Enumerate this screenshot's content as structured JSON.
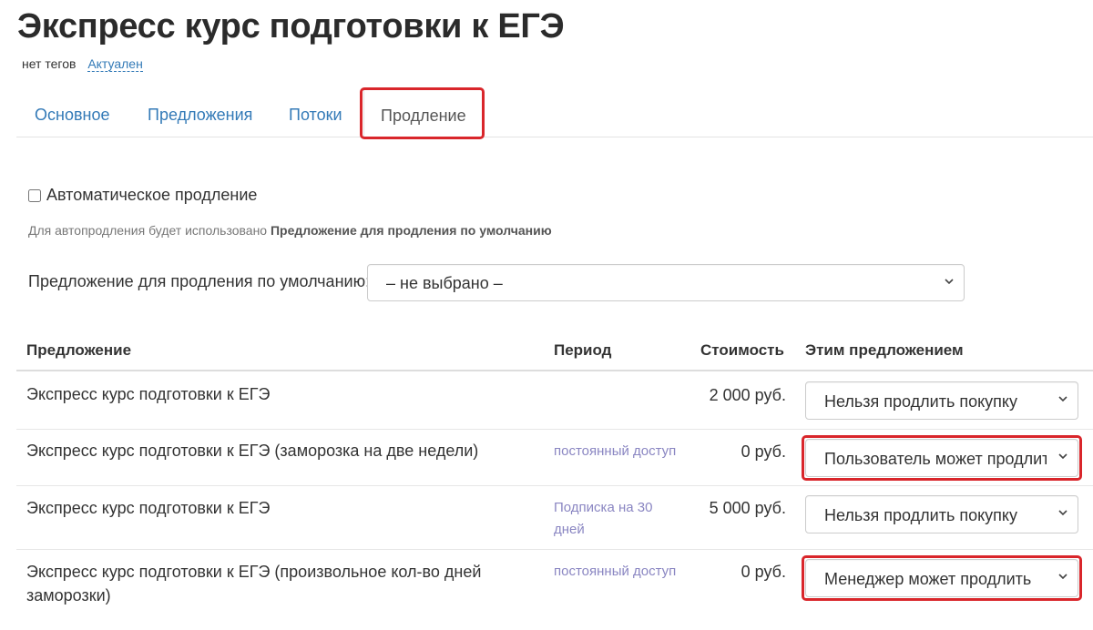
{
  "header": {
    "title": "Экспресс курс подготовки к ЕГЭ",
    "tags": "нет тегов",
    "status": "Актуален"
  },
  "tabs": [
    {
      "label": "Основное"
    },
    {
      "label": "Предложения"
    },
    {
      "label": "Потоки"
    },
    {
      "label": "Продление",
      "active": true
    }
  ],
  "renewal": {
    "auto_label": "Автоматическое продление",
    "auto_checked": false,
    "hint_prefix": "Для автопродления будет использовано ",
    "hint_bold": "Предложение для продления по умолчанию",
    "default_label": "Предложение для продления по умолчанию:",
    "default_value": "– не выбрано –"
  },
  "table": {
    "headers": [
      "Предложение",
      "Период",
      "Стоимость",
      "Этим предложением"
    ],
    "rows": [
      {
        "name": "Экспресс курс подготовки к ЕГЭ",
        "period": "",
        "price": "2 000 руб.",
        "action": "Нельзя продлить покупку",
        "highlighted": false
      },
      {
        "name": "Экспресс курс подготовки к ЕГЭ (заморозка на две недели)",
        "period": "постоянный доступ",
        "price": "0 руб.",
        "action": "Пользователь может продлить",
        "highlighted": true
      },
      {
        "name": "Экспресс курс подготовки к ЕГЭ",
        "period": "Подписка на 30 дней",
        "price": "5 000 руб.",
        "action": "Нельзя продлить покупку",
        "highlighted": false
      },
      {
        "name": "Экспресс курс подготовки к ЕГЭ (произвольное кол-во дней заморозки)",
        "period": "постоянный доступ",
        "price": "0 руб.",
        "action": "Менеджер может продлить",
        "highlighted": true
      }
    ]
  },
  "colors": {
    "link": "#337ab7",
    "highlight": "#d9262b",
    "period_text": "#8a86c2"
  },
  "icons": {
    "select_arrow": "chevron-down-icon"
  }
}
